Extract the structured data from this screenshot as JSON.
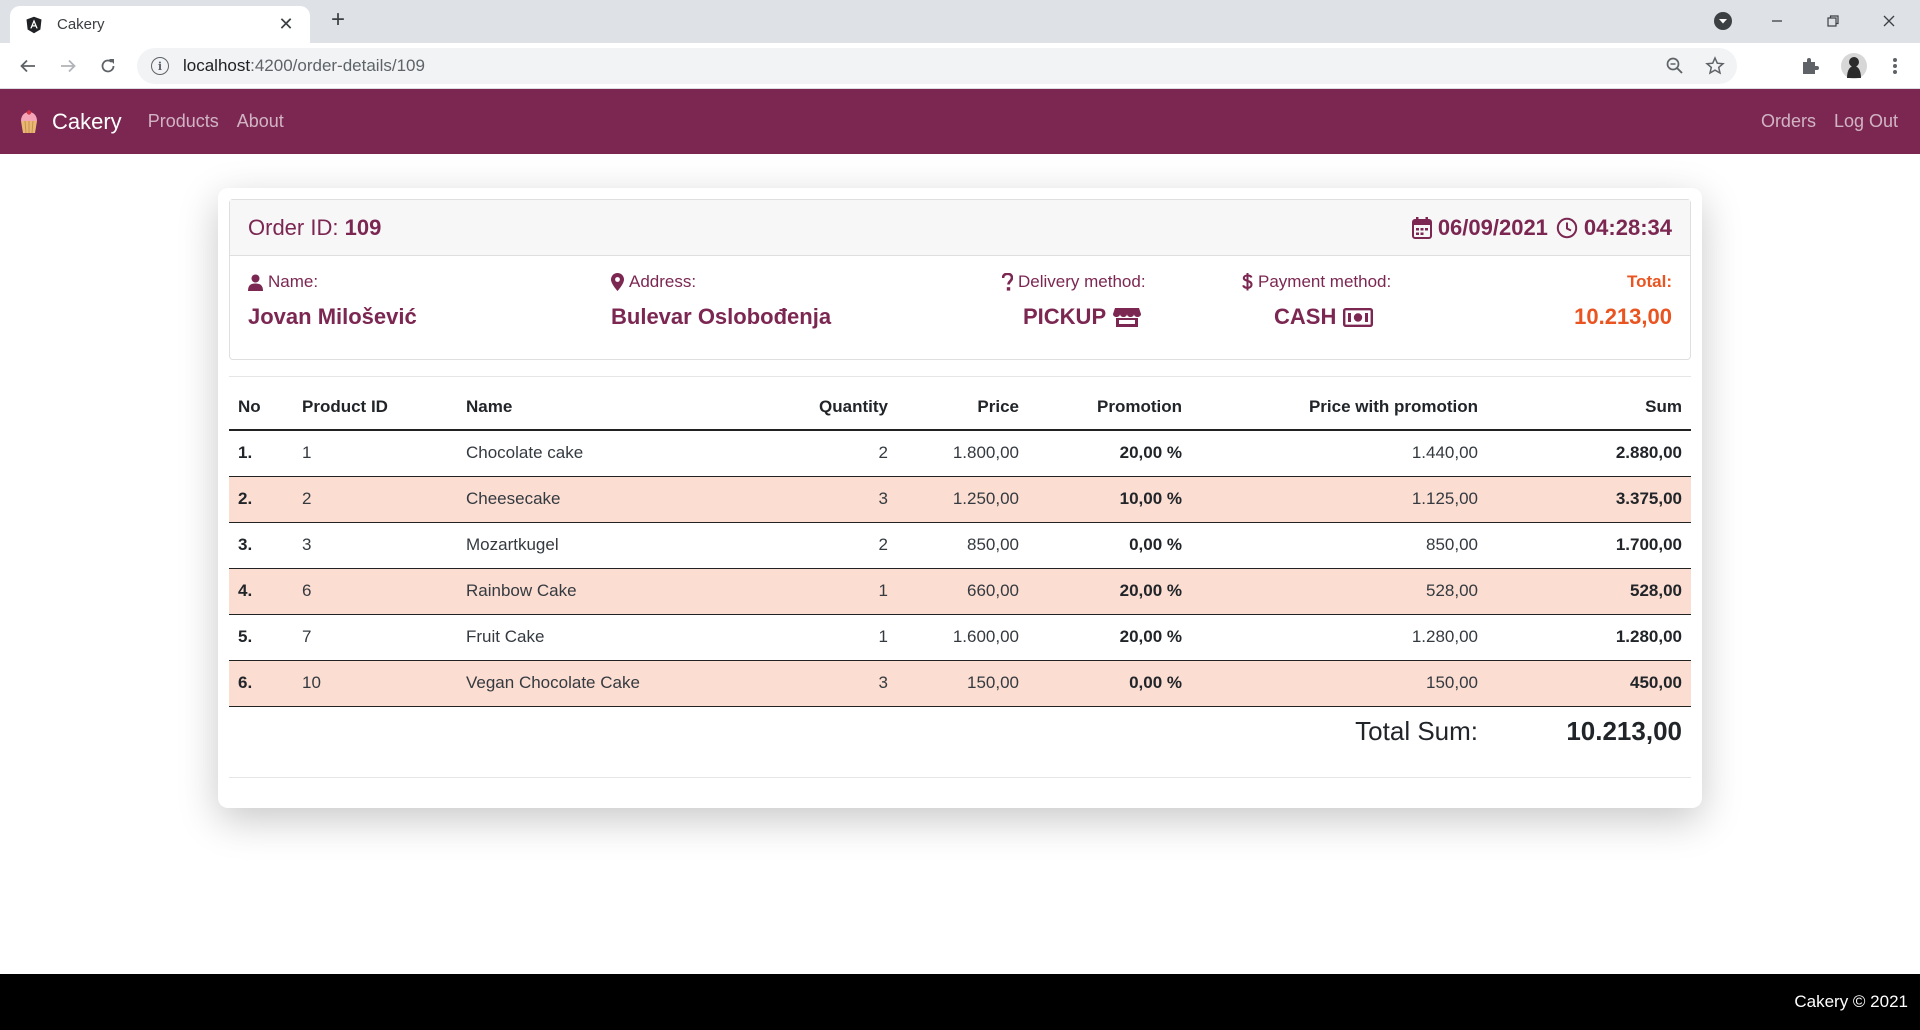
{
  "browser": {
    "tab_title": "Cakery",
    "tab_favicon": "angular-icon",
    "url_host": "localhost",
    "url_path": ":4200/order-details/109"
  },
  "navbar": {
    "brand": "Cakery",
    "links_left": [
      "Products",
      "About"
    ],
    "links_right": [
      "Orders",
      "Log Out"
    ],
    "color": "#7b2752"
  },
  "order": {
    "id_label": "Order ID:",
    "id": "109",
    "date": "06/09/2021",
    "time": "04:28:34",
    "name_label": "Name:",
    "name": "Jovan Milošević",
    "address_label": "Address:",
    "address": "Bulevar Oslobođenja",
    "delivery_label": "Delivery method:",
    "delivery": "PICKUP",
    "payment_label": "Payment method:",
    "payment": "CASH",
    "total_label": "Total:",
    "total": "10.213,00",
    "total_color": "#e95420"
  },
  "table": {
    "headers": [
      "No",
      "Product ID",
      "Name",
      "Quantity",
      "Price",
      "Promotion",
      "Price with promotion",
      "Sum"
    ],
    "rows": [
      {
        "no": "1.",
        "product_id": "1",
        "name": "Chocolate cake",
        "quantity": "2",
        "price": "1.800,00",
        "promotion": "20,00 %",
        "price_promo": "1.440,00",
        "sum": "2.880,00"
      },
      {
        "no": "2.",
        "product_id": "2",
        "name": "Cheesecake",
        "quantity": "3",
        "price": "1.250,00",
        "promotion": "10,00 %",
        "price_promo": "1.125,00",
        "sum": "3.375,00"
      },
      {
        "no": "3.",
        "product_id": "3",
        "name": "Mozartkugel",
        "quantity": "2",
        "price": "850,00",
        "promotion": "0,00 %",
        "price_promo": "850,00",
        "sum": "1.700,00"
      },
      {
        "no": "4.",
        "product_id": "6",
        "name": "Rainbow Cake",
        "quantity": "1",
        "price": "660,00",
        "promotion": "20,00 %",
        "price_promo": "528,00",
        "sum": "528,00"
      },
      {
        "no": "5.",
        "product_id": "7",
        "name": "Fruit Cake",
        "quantity": "1",
        "price": "1.600,00",
        "promotion": "20,00 %",
        "price_promo": "1.280,00",
        "sum": "1.280,00"
      },
      {
        "no": "6.",
        "product_id": "10",
        "name": "Vegan Chocolate Cake",
        "quantity": "3",
        "price": "150,00",
        "promotion": "0,00 %",
        "price_promo": "150,00",
        "sum": "450,00"
      }
    ],
    "total_label": "Total Sum:",
    "total_value": "10.213,00",
    "alt_row_color": "#fbddd2"
  },
  "footer": {
    "text": "Cakery © 2021"
  }
}
